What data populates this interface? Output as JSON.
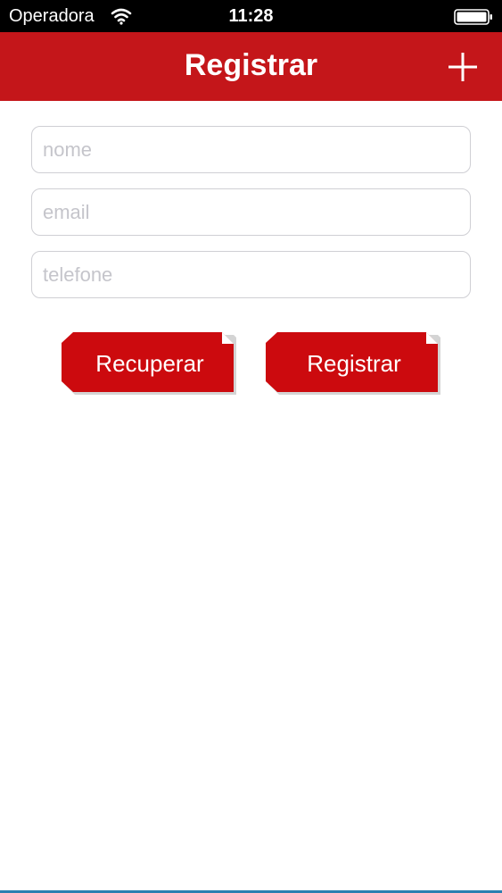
{
  "status_bar": {
    "carrier": "Operadora",
    "time": "11:28",
    "wifi_icon": "wifi-icon",
    "battery_icon": "battery-full-icon"
  },
  "nav_bar": {
    "title": "Registrar",
    "add_icon": "plus-icon",
    "background_color": "#c4161a"
  },
  "form": {
    "nome": {
      "value": "",
      "placeholder": "nome"
    },
    "email": {
      "value": "",
      "placeholder": "email"
    },
    "telefone": {
      "value": "",
      "placeholder": "telefone"
    }
  },
  "actions": {
    "recuperar_label": "Recuperar",
    "registrar_label": "Registrar",
    "button_color": "#cc0a0e"
  }
}
